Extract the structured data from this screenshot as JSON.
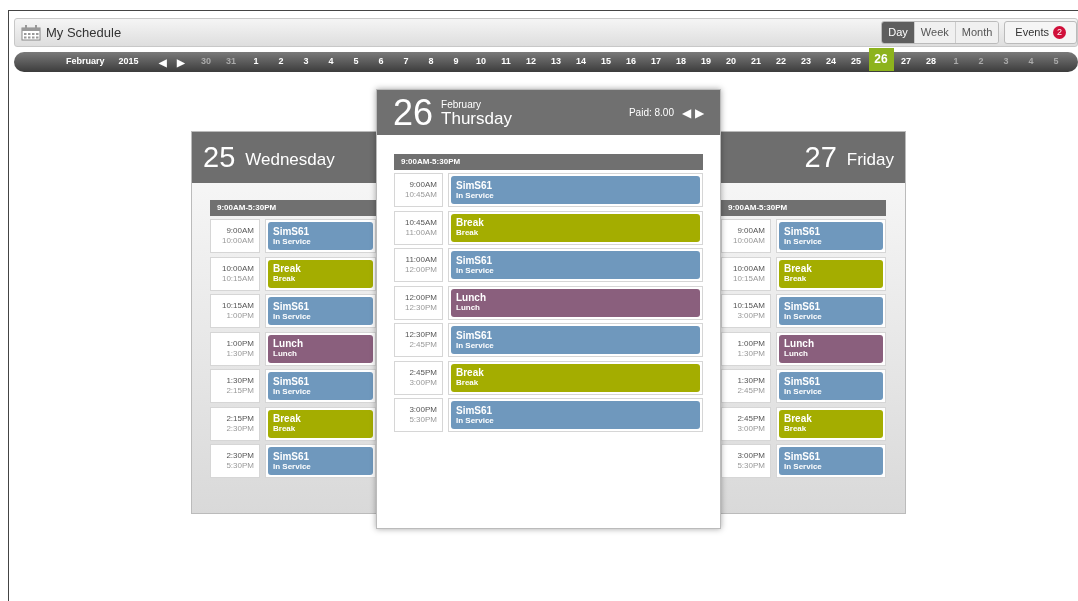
{
  "header": {
    "title": "My Schedule",
    "views": [
      {
        "label": "Day",
        "selected": true
      },
      {
        "label": "Week",
        "selected": false
      },
      {
        "label": "Month",
        "selected": false
      }
    ],
    "events": {
      "label": "Events",
      "count": "2"
    }
  },
  "date_strip": {
    "month": "February",
    "year": "2015",
    "prev": "◀",
    "next": "▶",
    "dates": [
      {
        "label": "30",
        "muted": true,
        "selected": false
      },
      {
        "label": "31",
        "muted": true,
        "selected": false
      },
      {
        "label": "1",
        "muted": false,
        "selected": false
      },
      {
        "label": "2",
        "muted": false,
        "selected": false
      },
      {
        "label": "3",
        "muted": false,
        "selected": false
      },
      {
        "label": "4",
        "muted": false,
        "selected": false
      },
      {
        "label": "5",
        "muted": false,
        "selected": false
      },
      {
        "label": "6",
        "muted": false,
        "selected": false
      },
      {
        "label": "7",
        "muted": false,
        "selected": false
      },
      {
        "label": "8",
        "muted": false,
        "selected": false
      },
      {
        "label": "9",
        "muted": false,
        "selected": false
      },
      {
        "label": "10",
        "muted": false,
        "selected": false
      },
      {
        "label": "11",
        "muted": false,
        "selected": false
      },
      {
        "label": "12",
        "muted": false,
        "selected": false
      },
      {
        "label": "13",
        "muted": false,
        "selected": false
      },
      {
        "label": "14",
        "muted": false,
        "selected": false
      },
      {
        "label": "15",
        "muted": false,
        "selected": false
      },
      {
        "label": "16",
        "muted": false,
        "selected": false
      },
      {
        "label": "17",
        "muted": false,
        "selected": false
      },
      {
        "label": "18",
        "muted": false,
        "selected": false
      },
      {
        "label": "19",
        "muted": false,
        "selected": false
      },
      {
        "label": "20",
        "muted": false,
        "selected": false
      },
      {
        "label": "21",
        "muted": false,
        "selected": false
      },
      {
        "label": "22",
        "muted": false,
        "selected": false
      },
      {
        "label": "23",
        "muted": false,
        "selected": false
      },
      {
        "label": "24",
        "muted": false,
        "selected": false
      },
      {
        "label": "25",
        "muted": false,
        "selected": false
      },
      {
        "label": "26",
        "muted": false,
        "selected": true
      },
      {
        "label": "27",
        "muted": false,
        "selected": false
      },
      {
        "label": "28",
        "muted": false,
        "selected": false
      },
      {
        "label": "1",
        "muted": true,
        "selected": false
      },
      {
        "label": "2",
        "muted": true,
        "selected": false
      },
      {
        "label": "3",
        "muted": true,
        "selected": false
      },
      {
        "label": "4",
        "muted": true,
        "selected": false
      },
      {
        "label": "5",
        "muted": true,
        "selected": false
      }
    ]
  },
  "days": [
    {
      "kind": "left",
      "day": "25",
      "weekday": "Wednesday",
      "shift": "9:00AM-5:30PM",
      "entries": [
        {
          "start": "9:00AM",
          "end": "10:00AM",
          "title": "SimS61",
          "subtitle": "In Service",
          "color": "#6f98bd"
        },
        {
          "start": "10:00AM",
          "end": "10:15AM",
          "title": "Break",
          "subtitle": "Break",
          "color": "#a4ad00"
        },
        {
          "start": "10:15AM",
          "end": "1:00PM",
          "title": "SimS61",
          "subtitle": "In Service",
          "color": "#6f98bd"
        },
        {
          "start": "1:00PM",
          "end": "1:30PM",
          "title": "Lunch",
          "subtitle": "Lunch",
          "color": "#8a5f7d"
        },
        {
          "start": "1:30PM",
          "end": "2:15PM",
          "title": "SimS61",
          "subtitle": "In Service",
          "color": "#6f98bd"
        },
        {
          "start": "2:15PM",
          "end": "2:30PM",
          "title": "Break",
          "subtitle": "Break",
          "color": "#a4ad00"
        },
        {
          "start": "2:30PM",
          "end": "5:30PM",
          "title": "SimS61",
          "subtitle": "In Service",
          "color": "#6f98bd"
        }
      ]
    },
    {
      "kind": "main",
      "day": "26",
      "month": "February",
      "weekday": "Thursday",
      "paid": "Paid: 8.00",
      "prev": "◀",
      "next": "▶",
      "shift": "9:00AM-5:30PM",
      "entries": [
        {
          "start": "9:00AM",
          "end": "10:45AM",
          "title": "SimS61",
          "subtitle": "In Service",
          "color": "#6f98bd"
        },
        {
          "start": "10:45AM",
          "end": "11:00AM",
          "title": "Break",
          "subtitle": "Break",
          "color": "#a4ad00"
        },
        {
          "start": "11:00AM",
          "end": "12:00PM",
          "title": "SimS61",
          "subtitle": "In Service",
          "color": "#6f98bd"
        },
        {
          "start": "12:00PM",
          "end": "12:30PM",
          "title": "Lunch",
          "subtitle": "Lunch",
          "color": "#8a5f7d"
        },
        {
          "start": "12:30PM",
          "end": "2:45PM",
          "title": "SimS61",
          "subtitle": "In Service",
          "color": "#6f98bd"
        },
        {
          "start": "2:45PM",
          "end": "3:00PM",
          "title": "Break",
          "subtitle": "Break",
          "color": "#a4ad00"
        },
        {
          "start": "3:00PM",
          "end": "5:30PM",
          "title": "SimS61",
          "subtitle": "In Service",
          "color": "#6f98bd"
        }
      ]
    },
    {
      "kind": "right",
      "day": "27",
      "weekday": "Friday",
      "shift": "9:00AM-5:30PM",
      "entries": [
        {
          "start": "9:00AM",
          "end": "10:00AM",
          "title": "SimS61",
          "subtitle": "In Service",
          "color": "#6f98bd"
        },
        {
          "start": "10:00AM",
          "end": "10:15AM",
          "title": "Break",
          "subtitle": "Break",
          "color": "#a4ad00"
        },
        {
          "start": "10:15AM",
          "end": "3:00PM",
          "title": "SimS61",
          "subtitle": "In Service",
          "color": "#6f98bd"
        },
        {
          "start": "1:00PM",
          "end": "1:30PM",
          "title": "Lunch",
          "subtitle": "Lunch",
          "color": "#8a5f7d"
        },
        {
          "start": "1:30PM",
          "end": "2:45PM",
          "title": "SimS61",
          "subtitle": "In Service",
          "color": "#6f98bd"
        },
        {
          "start": "2:45PM",
          "end": "3:00PM",
          "title": "Break",
          "subtitle": "Break",
          "color": "#a4ad00"
        },
        {
          "start": "3:00PM",
          "end": "5:30PM",
          "title": "SimS61",
          "subtitle": "In Service",
          "color": "#6f98bd"
        }
      ]
    }
  ]
}
